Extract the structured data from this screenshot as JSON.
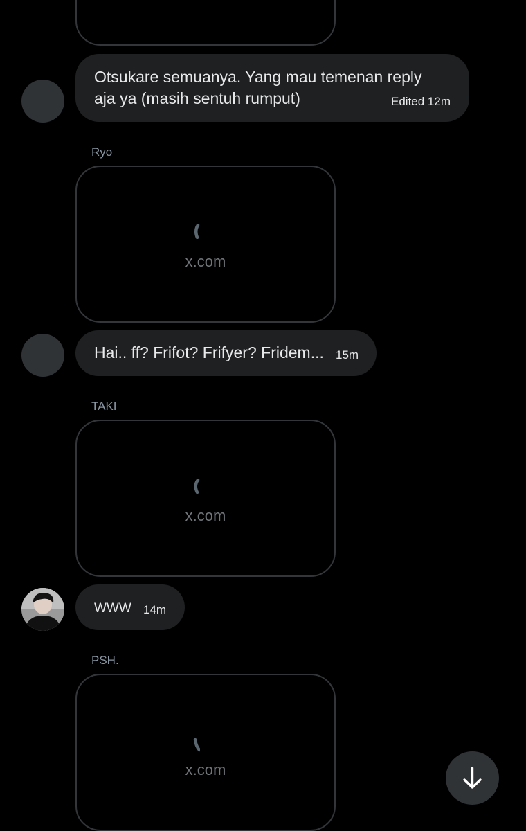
{
  "colors": {
    "background": "#000000",
    "bubble": "#1e2022",
    "card_border": "#333639",
    "avatar_placeholder": "#2f3336",
    "muted_text": "#71767b",
    "text": "#e7e9ea"
  },
  "link_cards": [
    {
      "domain": ""
    },
    {
      "domain": "x.com"
    },
    {
      "domain": "x.com"
    },
    {
      "domain": "x.com"
    }
  ],
  "messages": [
    {
      "line1": "Otsukare semuanya. Yang mau temenan reply",
      "line2": "aja ya (masih sentuh rumput)",
      "time": "Edited 12m"
    },
    {
      "text": "Hai.. ff? Frifot? Frifyer? Fridem...",
      "time": "15m"
    },
    {
      "text": "WWW",
      "time": "14m"
    }
  ],
  "senders": [
    "Ryo",
    "TAKI",
    "PSH."
  ],
  "icons": {
    "loading": "loading-spinner-icon",
    "scroll_down": "arrow-down-icon"
  }
}
